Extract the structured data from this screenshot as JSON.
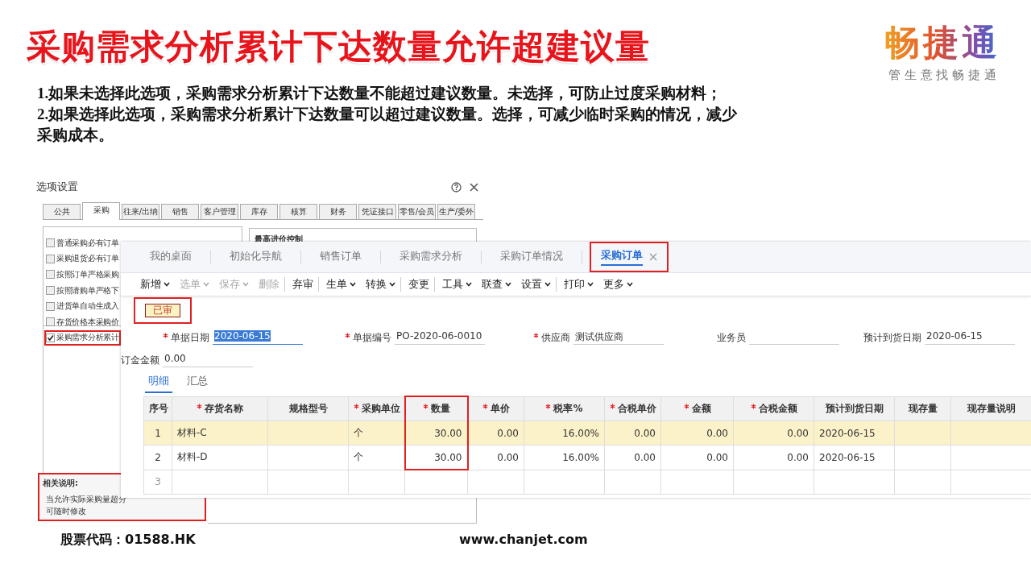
{
  "title": "采购需求分析累计下达数量允许超建议量",
  "logo": {
    "name": "畅捷通",
    "slogan": "管 生 意 找 畅 捷 通"
  },
  "notes": [
    "1.如果未选择此选项，采购需求分析累计下达数量不能超过建议数量。未选择，可防止过度采购材料；",
    "2.如果选择此选项，采购需求分析累计下达数量可以超过建议数量。选择，可减少临时采购的情况，减少采购成本。"
  ],
  "options_dialog": {
    "title": "选项设置",
    "tabs": [
      {
        "label": "公共",
        "selected": false
      },
      {
        "label": "采购",
        "selected": true
      },
      {
        "label": "往来/出纳",
        "selected": false
      },
      {
        "label": "销售",
        "selected": false
      },
      {
        "label": "客户管理",
        "selected": false
      },
      {
        "label": "库存",
        "selected": false
      },
      {
        "label": "核算",
        "selected": false
      },
      {
        "label": "财务",
        "selected": false
      },
      {
        "label": "凭证接口",
        "selected": false
      },
      {
        "label": "零售/会员",
        "selected": false
      },
      {
        "label": "生产/委外",
        "selected": false
      }
    ],
    "group_title": "最高进价控制",
    "options": [
      {
        "label": "普通采购必有订单",
        "checked": false,
        "highlighted": false
      },
      {
        "label": "采购退货必有订单",
        "checked": false,
        "highlighted": false
      },
      {
        "label": "按照订单严格采购",
        "checked": false,
        "highlighted": false
      },
      {
        "label": "按照请购单严格下",
        "checked": false,
        "highlighted": false
      },
      {
        "label": "进货单自动生成入",
        "checked": false,
        "highlighted": false
      },
      {
        "label": "存货价格本采购价",
        "checked": false,
        "highlighted": false
      },
      {
        "label": "采购需求分析累计",
        "checked": true,
        "highlighted": true
      }
    ],
    "related_note": {
      "heading": "相关说明:",
      "lines": [
        "当允许实际采购量超分",
        "可随时修改"
      ],
      "highlighted": true
    }
  },
  "order_window": {
    "tabs": [
      {
        "label": "我的桌面",
        "selected": false,
        "closable": false,
        "highlighted": false
      },
      {
        "label": "初始化导航",
        "selected": false,
        "closable": false,
        "highlighted": false
      },
      {
        "label": "销售订单",
        "selected": false,
        "closable": false,
        "highlighted": false
      },
      {
        "label": "采购需求分析",
        "selected": false,
        "closable": false,
        "highlighted": false
      },
      {
        "label": "采购订单情况",
        "selected": false,
        "closable": false,
        "highlighted": false
      },
      {
        "label": "采购订单",
        "selected": true,
        "closable": true,
        "highlighted": true
      }
    ],
    "toolbar": [
      {
        "label": "新增",
        "disabled": false,
        "dropdown": true,
        "separator_after": false
      },
      {
        "label": "选单",
        "disabled": true,
        "dropdown": true,
        "separator_after": false
      },
      {
        "label": "保存",
        "disabled": true,
        "dropdown": true,
        "separator_after": false
      },
      {
        "label": "删除",
        "disabled": true,
        "dropdown": false,
        "separator_after": true
      },
      {
        "label": "弃审",
        "disabled": false,
        "dropdown": false,
        "separator_after": true
      },
      {
        "label": "生单",
        "disabled": false,
        "dropdown": true,
        "separator_after": false
      },
      {
        "label": "转换",
        "disabled": false,
        "dropdown": true,
        "separator_after": true
      },
      {
        "label": "变更",
        "disabled": false,
        "dropdown": false,
        "separator_after": true
      },
      {
        "label": "工具",
        "disabled": false,
        "dropdown": true,
        "separator_after": false
      },
      {
        "label": "联查",
        "disabled": false,
        "dropdown": true,
        "separator_after": false
      },
      {
        "label": "设置",
        "disabled": false,
        "dropdown": true,
        "separator_after": true
      },
      {
        "label": "打印",
        "disabled": false,
        "dropdown": true,
        "separator_after": false
      },
      {
        "label": "更多",
        "disabled": false,
        "dropdown": true,
        "separator_after": false
      }
    ],
    "status_badge": {
      "label": "已审",
      "highlighted": true
    },
    "fields": [
      {
        "label": "单据日期",
        "required": true,
        "value": "2020-06-15",
        "selected": true
      },
      {
        "label": "单据编号",
        "required": true,
        "value": "PO-2020-06-0010",
        "selected": false
      },
      {
        "label": "供应商",
        "required": true,
        "value": "测试供应商",
        "selected": false
      },
      {
        "label": "业务员",
        "required": false,
        "selected": false
      },
      {
        "label": "预计到货日期",
        "required": false,
        "value": "2020-06-15",
        "selected": false
      },
      {
        "label": "订金金额",
        "required": false,
        "value": "0.00",
        "selected": false
      }
    ],
    "subtabs": [
      {
        "label": "明细",
        "selected": true
      },
      {
        "label": "汇总",
        "selected": false
      }
    ],
    "table": {
      "columns": [
        {
          "label": "序号",
          "required": false,
          "highlighted": false
        },
        {
          "label": "存货名称",
          "required": true,
          "highlighted": false
        },
        {
          "label": "规格型号",
          "required": false,
          "highlighted": false
        },
        {
          "label": "采购单位",
          "required": true,
          "highlighted": false
        },
        {
          "label": "数量",
          "required": true,
          "highlighted": true
        },
        {
          "label": "单价",
          "required": true,
          "highlighted": false
        },
        {
          "label": "税率%",
          "required": true,
          "highlighted": false
        },
        {
          "label": "合税单价",
          "required": true,
          "highlighted": false
        },
        {
          "label": "金额",
          "required": true,
          "highlighted": false
        },
        {
          "label": "合税金额",
          "required": true,
          "highlighted": false
        },
        {
          "label": "预计到货日期",
          "required": false,
          "highlighted": false
        },
        {
          "label": "现存量",
          "required": false,
          "highlighted": false
        },
        {
          "label": "现存量说明",
          "required": false,
          "highlighted": false
        }
      ],
      "rows": [
        {
          "selected": true,
          "cells": [
            "1",
            "材料-C",
            "",
            "个",
            "30.00",
            "0.00",
            "16.00%",
            "0.00",
            "0.00",
            "0.00",
            "2020-06-15",
            "",
            ""
          ]
        },
        {
          "selected": false,
          "cells": [
            "2",
            "材料-D",
            "",
            "个",
            "30.00",
            "0.00",
            "16.00%",
            "0.00",
            "0.00",
            "0.00",
            "2020-06-15",
            "",
            ""
          ]
        },
        {
          "selected": false,
          "cells": [
            "3",
            "",
            "",
            "",
            "",
            "",
            "",
            "",
            "",
            "",
            "",
            "",
            ""
          ]
        }
      ]
    }
  },
  "footer": {
    "stock_code": "股票代码：01588.HK",
    "website": "www.chanjet.com"
  }
}
